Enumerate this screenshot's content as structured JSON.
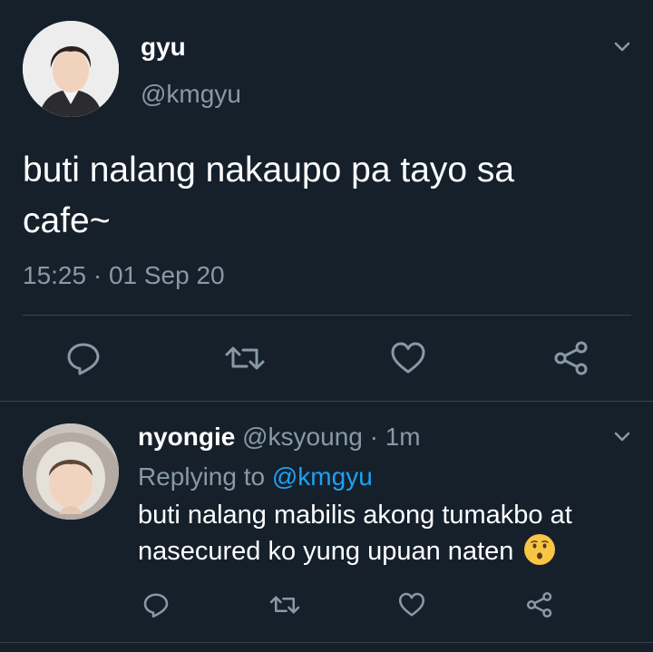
{
  "tweet": {
    "author_name": "gyu",
    "author_handle": "@kmgyu",
    "text_line1": "buti nalang nakaupo pa tayo sa",
    "text_line2": "cafe~",
    "timestamp": "15:25 · 01 Sep 20"
  },
  "reply": {
    "author_name": "nyongie",
    "author_handle": "@ksyoung",
    "separator": "·",
    "time_ago": "1m",
    "replying_to_label": "Replying to",
    "replying_to_handle": "@kmgyu",
    "text_line1": "buti nalang mabilis akong tumakbo at",
    "text_line2": "nasecured ko yung upuan naten",
    "emoji": "hushed-face-emoji"
  },
  "icons": {
    "more": "chevron-down-icon",
    "reply": "reply-icon",
    "retweet": "retweet-icon",
    "like": "heart-icon",
    "share": "share-icon"
  },
  "colors": {
    "background": "#15202b",
    "muted": "#8899a6",
    "link": "#1da1f2",
    "divider": "#38444d"
  }
}
